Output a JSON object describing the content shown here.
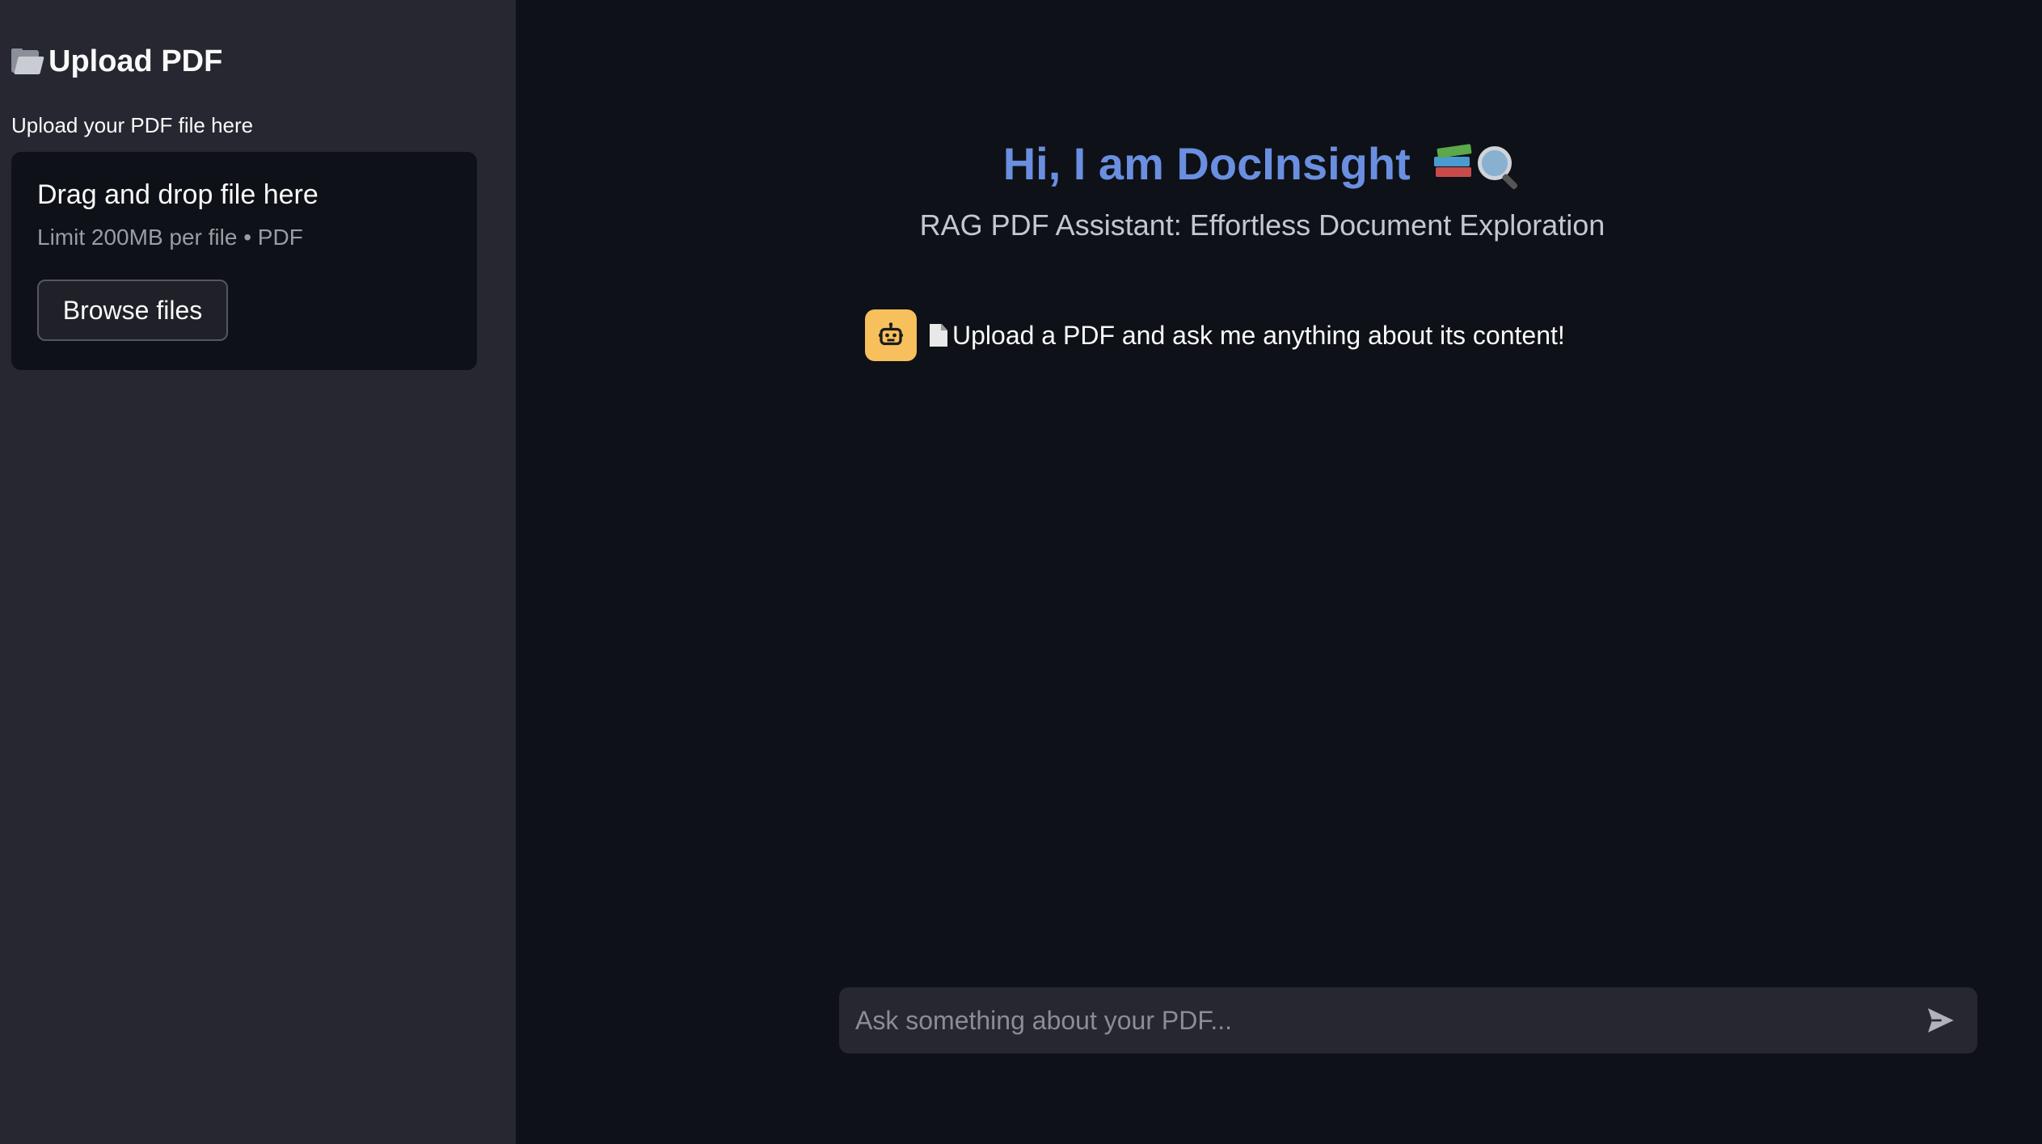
{
  "sidebar": {
    "title": "Upload PDF",
    "title_icon": "folder-icon",
    "upload_label": "Upload your PDF file here",
    "dropzone": {
      "title": "Drag and drop file here",
      "limit": "Limit 200MB per file • PDF",
      "browse_label": "Browse files"
    }
  },
  "main": {
    "heading": "Hi, I am DocInsight",
    "heading_icons": [
      "books-icon",
      "magnifier-icon"
    ],
    "subheading": "RAG PDF Assistant: Effortless Document Exploration",
    "messages": [
      {
        "role": "assistant",
        "avatar_icon": "robot-icon",
        "prefix_icon": "page-icon",
        "text": "Upload a PDF and ask me anything about its content!"
      }
    ],
    "chat_input": {
      "placeholder": "Ask something about your PDF...",
      "send_icon": "send-icon"
    }
  },
  "colors": {
    "sidebar_bg": "#262730",
    "main_bg": "#0e1117",
    "heading": "#6a8fe0",
    "bot_avatar": "#f7c05c"
  }
}
